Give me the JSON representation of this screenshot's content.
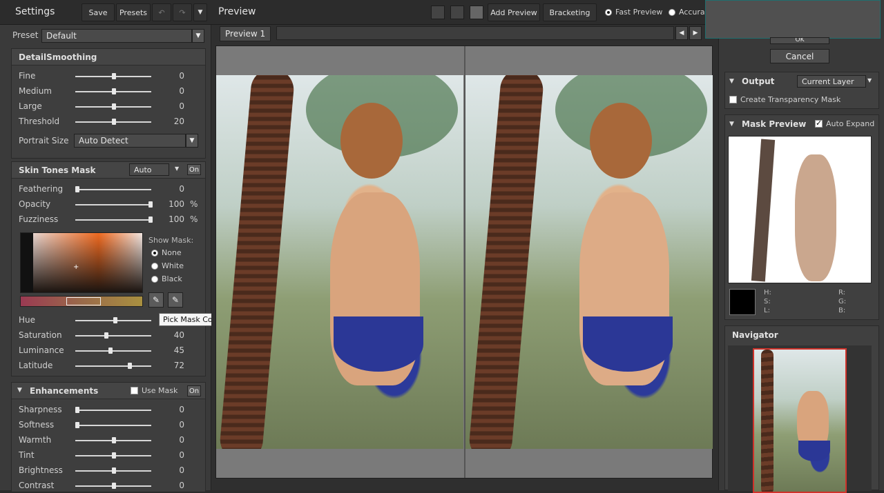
{
  "left": {
    "title": "Settings",
    "save_label": "Save",
    "presets_label": "Presets",
    "preset_label": "Preset",
    "preset_value": "Default",
    "detail": {
      "title": "DetailSmoothing",
      "sliders": [
        {
          "label": "Fine",
          "value": "0",
          "pos": 0.5
        },
        {
          "label": "Medium",
          "value": "0",
          "pos": 0.5
        },
        {
          "label": "Large",
          "value": "0",
          "pos": 0.5
        },
        {
          "label": "Threshold",
          "value": "20",
          "pos": 0.5
        }
      ],
      "portrait_label": "Portrait Size",
      "portrait_value": "Auto Detect"
    },
    "skin": {
      "title": "Skin Tones Mask",
      "mode": "Auto",
      "on_label": "On",
      "sliders": [
        {
          "label": "Feathering",
          "value": "0",
          "unit": "",
          "pos": 0.0
        },
        {
          "label": "Opacity",
          "value": "100",
          "unit": "%",
          "pos": 1.0
        },
        {
          "label": "Fuzziness",
          "value": "100",
          "unit": "%",
          "pos": 1.0
        }
      ],
      "show_mask_label": "Show Mask:",
      "mask_options": [
        "None",
        "White",
        "Black"
      ],
      "mask_selected": "None",
      "tooltip": "Pick Mask Color",
      "hsl_sliders": [
        {
          "label": "Hue",
          "value": "",
          "pos": 0.52
        },
        {
          "label": "Saturation",
          "value": "40",
          "pos": 0.4
        },
        {
          "label": "Luminance",
          "value": "45",
          "pos": 0.45
        },
        {
          "label": "Latitude",
          "value": "72",
          "pos": 0.72
        }
      ]
    },
    "enh": {
      "title": "Enhancements",
      "use_mask_label": "Use Mask",
      "on_label": "On",
      "sliders": [
        {
          "label": "Sharpness",
          "value": "0",
          "pos": 0.0
        },
        {
          "label": "Softness",
          "value": "0",
          "pos": 0.0
        },
        {
          "label": "Warmth",
          "value": "0",
          "pos": 0.5
        },
        {
          "label": "Tint",
          "value": "0",
          "pos": 0.5
        },
        {
          "label": "Brightness",
          "value": "0",
          "pos": 0.5
        },
        {
          "label": "Contrast",
          "value": "0",
          "pos": 0.5
        }
      ]
    }
  },
  "center": {
    "title": "Preview",
    "add_preview": "Add Preview",
    "bracketing": "Bracketing",
    "fast_preview": "Fast Preview",
    "accurate": "Accura",
    "tab": "Preview 1"
  },
  "right": {
    "ok_label": "OK",
    "cancel_label": "Cancel",
    "output_title": "Output",
    "output_value": "Current Layer",
    "transparency_label": "Create Transparency Mask",
    "mask_preview_title": "Mask Preview",
    "auto_expand_label": "Auto Expand",
    "h": "H:",
    "s": "S:",
    "l": "L:",
    "r": "R:",
    "g": "G:",
    "b": "B:",
    "navigator_title": "Navigator"
  },
  "colors": {
    "accent_red": "#d0322a",
    "swatch": "#000000"
  }
}
